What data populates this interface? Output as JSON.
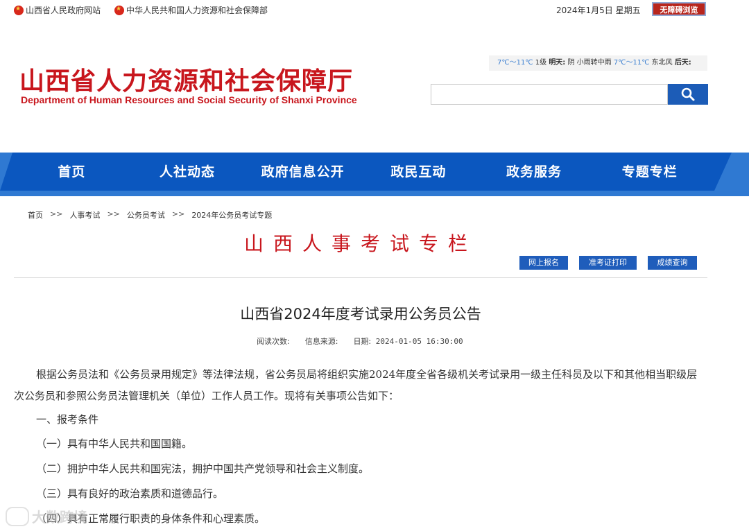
{
  "topbar": {
    "link1": "山西省人民政府网站",
    "link2": "中华人民共和国人力资源和社会保障部",
    "date": "2024年1月5日 星期五",
    "accessibility": "无障碍浏览"
  },
  "header": {
    "title_cn": "山西省人力资源和社会保障厅",
    "title_en": "Department of Human Resources and Social Security of Shanxi Province"
  },
  "weather": {
    "t1": "7℃～11℃",
    "w1": "1级",
    "tomorrow_label": "明天:",
    "tomorrow_cond": "阴 小雨转中雨",
    "t2": "7℃～11℃",
    "w2": "东北风",
    "after_label": "后天:"
  },
  "search": {
    "placeholder": "",
    "icon": "search-icon"
  },
  "nav": [
    "首页",
    "人社动态",
    "政府信息公开",
    "政民互动",
    "政务服务",
    "专题专栏"
  ],
  "breadcrumb": [
    "首页",
    "人事考试",
    "公务员考试",
    "2024年公务员考试专题"
  ],
  "breadcrumb_sep": ">>",
  "column_title": "山西人事考试专栏",
  "actions": [
    "网上报名",
    "准考证打印",
    "成绩查询"
  ],
  "article": {
    "title": "山西省2024年度考试录用公务员公告",
    "meta_reads": "阅读次数:",
    "meta_source": "信息来源:",
    "meta_date_label": "日期:",
    "meta_date": "2024-01-05 16:30:00",
    "para1": "根据公务员法和《公务员录用规定》等法律法规，省公务员局将组织实施2024年度全省各级机关考试录用一级主任科员及以下和其他相当职级层次公务员和参照公务员法管理机关（单位）工作人员工作。现将有关事项公告如下：",
    "section1": "一、报考条件",
    "item1": "（一）具有中华人民共和国国籍。",
    "item2": "（二）拥护中华人民共和国宪法，拥护中国共产党领导和社会主义制度。",
    "item3": "（三）具有良好的政治素质和道德品行。",
    "item4": "（四）具有正常履行职责的身体条件和心理素质。"
  },
  "watermark": "大数跨境",
  "colors": {
    "brand_red": "#c8161d",
    "nav_blue": "#0b57bf",
    "button_blue": "#1f5dbb"
  }
}
